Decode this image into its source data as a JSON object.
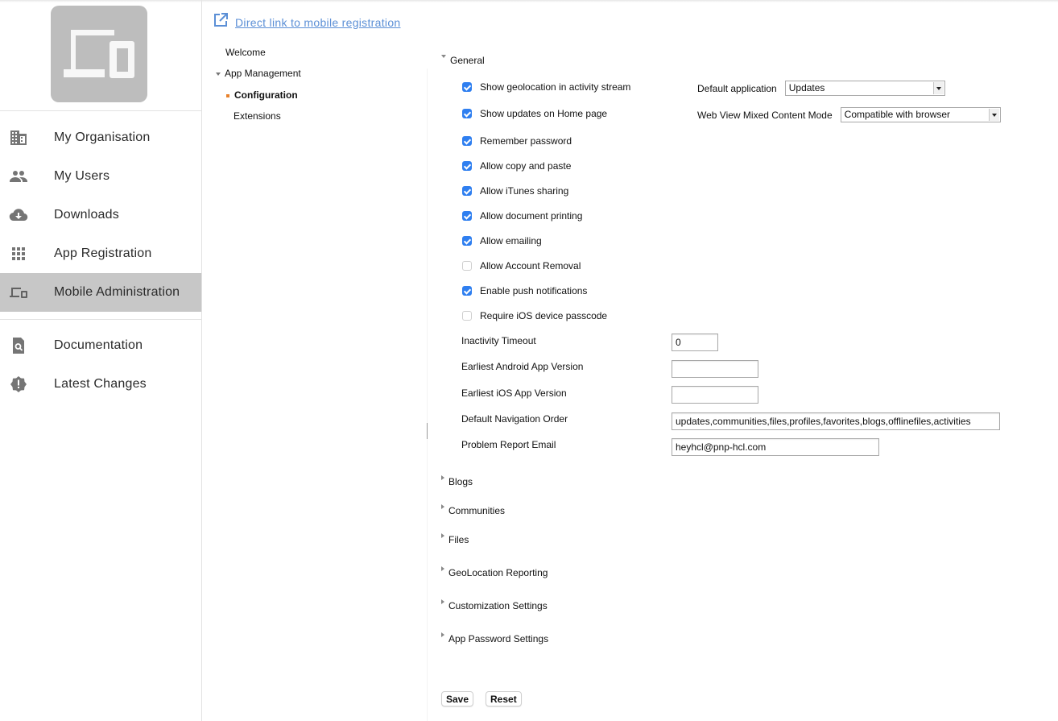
{
  "sidebar": {
    "logo_icon": "devices-icon",
    "items": [
      {
        "label": "My Organisation",
        "icon": "building-icon",
        "active": false
      },
      {
        "label": "My Users",
        "icon": "people-icon",
        "active": false
      },
      {
        "label": "Downloads",
        "icon": "cloud-download-icon",
        "active": false
      },
      {
        "label": "App Registration",
        "icon": "apps-grid-icon",
        "active": false
      },
      {
        "label": "Mobile Administration",
        "icon": "devices-icon",
        "active": true
      }
    ],
    "items2": [
      {
        "label": "Documentation",
        "icon": "doc-search-icon"
      },
      {
        "label": "Latest Changes",
        "icon": "alert-badge-icon"
      }
    ]
  },
  "header": {
    "direct_link_label": "Direct link to mobile registration",
    "direct_link_icon": "external-link-icon"
  },
  "tree": {
    "welcome": "Welcome",
    "app_management": "App Management",
    "configuration": "Configuration",
    "extensions": "Extensions"
  },
  "general": {
    "title": "General",
    "checkboxes": [
      {
        "label": "Show geolocation in activity stream",
        "checked": true
      },
      {
        "label": "Show updates on Home page",
        "checked": true
      },
      {
        "label": "Remember password",
        "checked": true
      },
      {
        "label": "Allow copy and paste",
        "checked": true
      },
      {
        "label": "Allow iTunes sharing",
        "checked": true
      },
      {
        "label": "Allow document printing",
        "checked": true
      },
      {
        "label": "Allow emailing",
        "checked": true
      },
      {
        "label": "Allow Account Removal",
        "checked": false
      },
      {
        "label": "Enable push notifications",
        "checked": true
      },
      {
        "label": "Require iOS device passcode",
        "checked": false
      }
    ],
    "default_application": {
      "label": "Default application",
      "value": "Updates"
    },
    "web_view_mode": {
      "label": "Web View Mixed Content Mode",
      "value": "Compatible with browser"
    },
    "fields": {
      "inactivity_timeout": {
        "label": "Inactivity Timeout",
        "value": "0"
      },
      "earliest_android": {
        "label": "Earliest Android App Version",
        "value": ""
      },
      "earliest_ios": {
        "label": "Earliest iOS App Version",
        "value": ""
      },
      "nav_order": {
        "label": "Default Navigation Order",
        "value": "updates,communities,files,profiles,favorites,blogs,offlinefiles,activities"
      },
      "problem_email": {
        "label": "Problem Report Email",
        "value": "heyhcl@pnp-hcl.com"
      }
    }
  },
  "sections": [
    {
      "title": "Blogs"
    },
    {
      "title": "Communities"
    },
    {
      "title": "Files"
    },
    {
      "title": "GeoLocation Reporting"
    },
    {
      "title": "Customization Settings"
    },
    {
      "title": "App Password Settings"
    }
  ],
  "actions": {
    "save": "Save",
    "reset": "Reset"
  },
  "colors": {
    "accent_link": "#5b8fd6",
    "checkbox_on": "#2f7ff0",
    "tree_bullet": "#e8812b",
    "active_nav": "#c7c7c7"
  }
}
